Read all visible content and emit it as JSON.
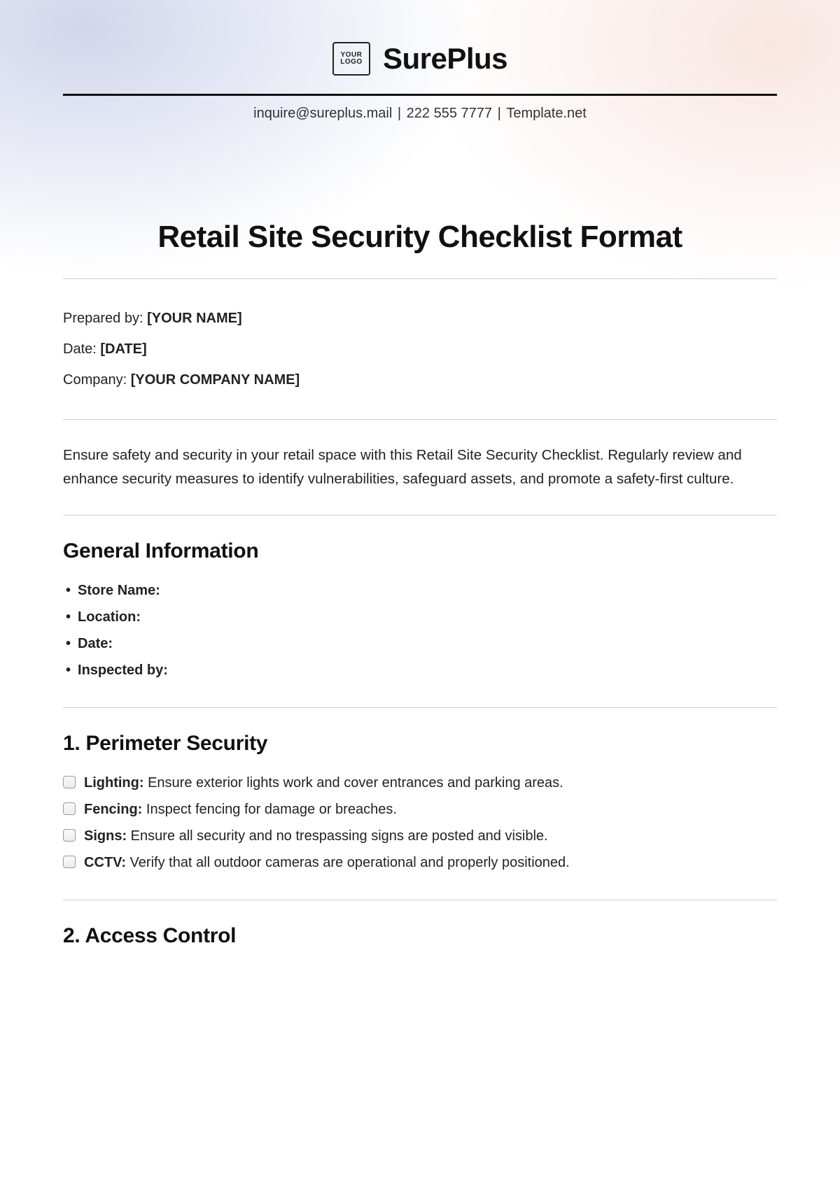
{
  "header": {
    "logo_text": "YOUR\nLOGO",
    "brand": "SurePlus",
    "contact_email": "inquire@sureplus.mail",
    "contact_phone": "222 555 7777",
    "contact_site": "Template.net"
  },
  "title": "Retail Site Security Checklist Format",
  "meta": {
    "prepared_by_label": "Prepared by: ",
    "prepared_by_value": "[YOUR NAME]",
    "date_label": "Date: ",
    "date_value": "[DATE]",
    "company_label": "Company: ",
    "company_value": "[YOUR COMPANY NAME]"
  },
  "intro": "Ensure safety and security in your retail space with this Retail Site Security Checklist. Regularly review and enhance security measures to identify vulnerabilities, safeguard assets, and promote a safety-first culture.",
  "general": {
    "heading": "General Information",
    "items": [
      "Store Name:",
      "Location:",
      "Date:",
      "Inspected by:"
    ]
  },
  "section1": {
    "heading": "1. Perimeter Security",
    "items": [
      {
        "label": "Lighting:",
        "text": " Ensure exterior lights work and cover entrances and parking areas."
      },
      {
        "label": "Fencing:",
        "text": " Inspect fencing for damage or breaches."
      },
      {
        "label": "Signs:",
        "text": " Ensure all security and no trespassing signs are posted and visible."
      },
      {
        "label": "CCTV:",
        "text": " Verify that all outdoor cameras are operational and properly positioned."
      }
    ]
  },
  "section2": {
    "heading": "2. Access Control"
  }
}
